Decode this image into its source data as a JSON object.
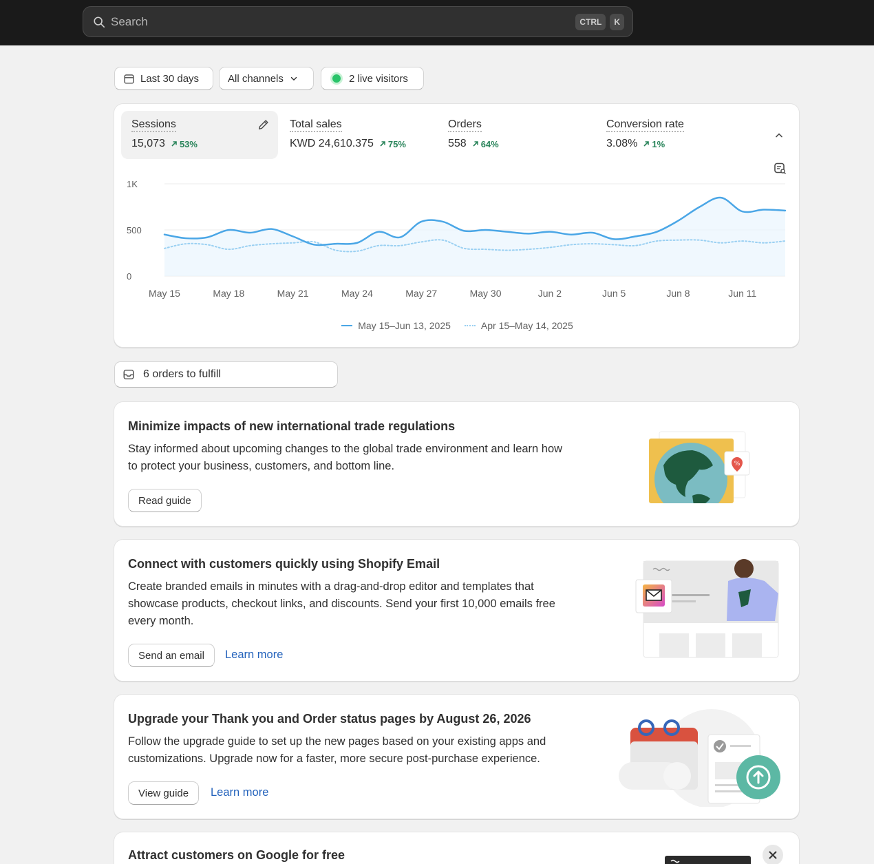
{
  "search": {
    "placeholder": "Search",
    "kbd1": "CTRL",
    "kbd2": "K"
  },
  "filters": {
    "date_range": "Last 30 days",
    "channels": "All channels",
    "live_visitors": "2 live visitors"
  },
  "metrics": [
    {
      "label": "Sessions",
      "value": "15,073",
      "change": "53%"
    },
    {
      "label": "Total sales",
      "value": "KWD 24,610.375",
      "change": "75%"
    },
    {
      "label": "Orders",
      "value": "558",
      "change": "64%"
    },
    {
      "label": "Conversion rate",
      "value": "3.08%",
      "change": "1%"
    }
  ],
  "chart_data": {
    "type": "line",
    "ylim": [
      0,
      1000
    ],
    "y_ticks": [
      "0",
      "500",
      "1K"
    ],
    "x_tick_labels": [
      "May 15",
      "May 18",
      "May 21",
      "May 24",
      "May 27",
      "May 30",
      "Jun 2",
      "Jun 5",
      "Jun 8",
      "Jun 11"
    ],
    "x_days": 30,
    "grid": true,
    "legend_position": "bottom",
    "series": [
      {
        "name": "May 15–Jun 13, 2025",
        "color": "#4aa6e6",
        "style": "solid",
        "values": [
          450,
          410,
          420,
          500,
          470,
          510,
          430,
          340,
          350,
          360,
          480,
          420,
          590,
          590,
          490,
          500,
          480,
          460,
          480,
          450,
          470,
          400,
          430,
          480,
          600,
          750,
          850,
          700,
          720,
          710
        ]
      },
      {
        "name": "Apr 15–May 14, 2025",
        "color": "#9ad0f2",
        "style": "dotted",
        "values": [
          300,
          350,
          340,
          290,
          330,
          350,
          360,
          370,
          280,
          270,
          330,
          330,
          370,
          390,
          300,
          290,
          280,
          290,
          310,
          340,
          350,
          340,
          330,
          380,
          390,
          390,
          360,
          380,
          360,
          380
        ]
      }
    ]
  },
  "orders_to_fulfill": "6 orders to fulfill",
  "promos": [
    {
      "title": "Minimize impacts of new international trade regulations",
      "body_line1": "Stay informed about upcoming changes to the global trade environment and learn how",
      "body_line2": "to protect your business, customers, and bottom line.",
      "primary": "Read guide"
    },
    {
      "title": "Connect with customers quickly using Shopify Email",
      "body_line1": "Create branded emails in minutes with a drag-and-drop editor and templates that",
      "body_line2": "showcase products, checkout links, and discounts. Send your first 10,000 emails free",
      "body_line3": "every month.",
      "primary": "Send an email",
      "secondary": "Learn more"
    },
    {
      "title": "Upgrade your Thank you and Order status pages by August 26, 2026",
      "body_line1": "Follow the upgrade guide to set up the new pages based on your existing apps and",
      "body_line2": "customizations. Upgrade now for a faster, more secure post-purchase experience.",
      "primary": "View guide",
      "secondary": "Learn more"
    },
    {
      "title": "Attract customers on Google for free"
    }
  ],
  "icons": {
    "search": "search-icon",
    "calendar": "calendar-icon",
    "chevron": "chevron-down-icon",
    "edit": "pencil-icon",
    "collapse": "chevron-up-icon",
    "chart_settings": "chart-search-icon",
    "inbox": "inbox-icon",
    "close": "close-icon"
  }
}
